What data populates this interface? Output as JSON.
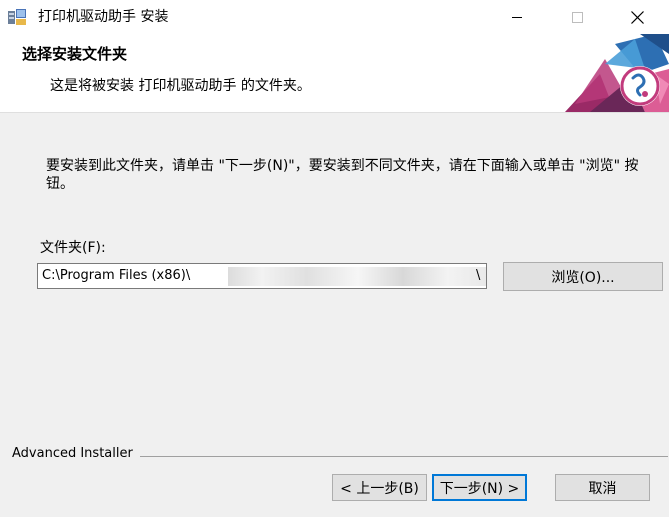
{
  "window": {
    "title": "打印机驱动助手 安装",
    "controls": {
      "minimize": "minimize-icon",
      "maximize": "maximize-icon",
      "close": "close-icon"
    }
  },
  "header": {
    "title": "选择安装文件夹",
    "subtitle": "这是将被安装 打印机驱动助手 的文件夹。"
  },
  "body": {
    "instructions": "要安装到此文件夹，请单击 \"下一步(N)\"，要安装到不同文件夹，请在下面输入或单击 \"浏览\" 按钮。",
    "folder_label": "文件夹(F):",
    "folder_value": "C:\\Program Files (x86)\\",
    "folder_value_end": "\\",
    "browse_label": "浏览(O)..."
  },
  "footer": {
    "brand": "Advanced Installer",
    "back_label": "< 上一步(B)",
    "next_label": "下一步(N) >",
    "cancel_label": "取消"
  },
  "colors": {
    "accent": "#0078d7",
    "window_bg": "#f0f0f0",
    "header_bg": "#ffffff"
  }
}
